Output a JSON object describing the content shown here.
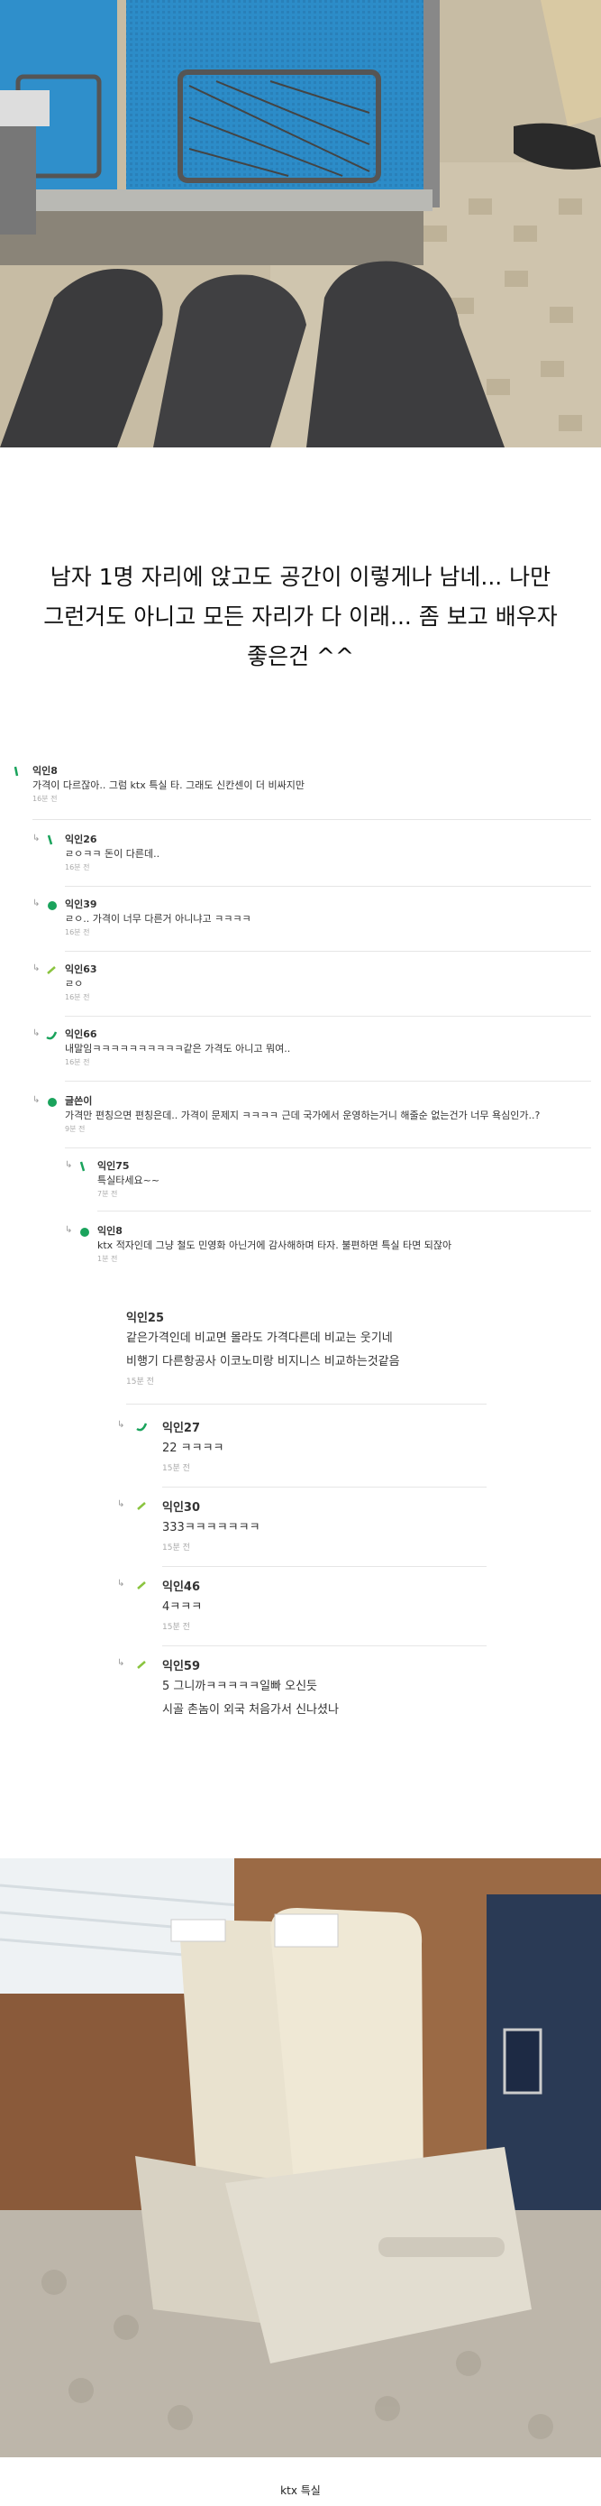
{
  "post": {
    "caption": "남자 1명 자리에 앉고도 공간이 이렇게나 남네... 나만\n그런거도 아니고 모든 자리가 다 이래... 좀 보고 배우자\n좋은건 ^^",
    "photo_bottom_caption": "ktx 특실"
  },
  "comments": [
    {
      "author": "익인8",
      "body": "가격이 다르잖아.. 그럼 ktx 특실 타. 그래도 신칸센이 더 비싸지만",
      "time": "16분 전"
    },
    {
      "author": "익인26",
      "body": "ㄹㅇㅋㅋ 돈이 다른데..",
      "time": "16분 전"
    },
    {
      "author": "익인39",
      "body": "ㄹㅇ.. 가격이 너무 다른거 아니냐고 ㅋㅋㅋㅋ",
      "time": "16분 전"
    },
    {
      "author": "익인63",
      "body": "ㄹㅇ",
      "time": "16분 전"
    },
    {
      "author": "익인66",
      "body": "내말임ㅋㅋㅋㅋㅋㅋㅋㅋㅋㅋ같은 가격도 아니고 뭐여..",
      "time": "16분 전"
    },
    {
      "author": "글쓴이",
      "body": "가격만 편칭으면 편칭은데.. 가격이 문제지 ㅋㅋㅋㅋ 근데 국가에서 운영하는거니 해줄순 없는건가 너무 욕심인가..?",
      "time": "9분 전"
    },
    {
      "author": "익인75",
      "body": "특실타세요~~",
      "time": "7분 전"
    },
    {
      "author": "익인8",
      "body": "ktx 적자인데 그냥 철도 민영화 아닌거에 감사해하며 타자. 불편하면 특실 타면 되잖아",
      "time": "1분 전"
    }
  ],
  "big_comments": [
    {
      "author": "익인25",
      "body_lines": [
        "같은가격인데 비교면 몰라도 가격다른데 비교는 웃기네",
        "비행기 다른항공사 이코노미랑 비지니스 비교하는것같음"
      ],
      "time": "15분 전"
    },
    {
      "author": "익인27",
      "body": "22 ㅋㅋㅋㅋ",
      "time": "15분 전"
    },
    {
      "author": "익인30",
      "body": "333ㅋㅋㅋㅋㅋㅋㅋ",
      "time": "15분 전"
    },
    {
      "author": "익인46",
      "body": "4ㅋㅋㅋ",
      "time": "15분 전"
    },
    {
      "author": "익인59",
      "body_lines": [
        "5 그니까ㅋㅋㅋㅋㅋ일빠 오신듯",
        "시골 촌놈이 외국 처음가서 신나셨나"
      ],
      "time": ""
    }
  ],
  "colors": {
    "accent_green": "#1aa35c",
    "seat_blue": "#2e8fc9",
    "cream_seat": "#e8e0cc"
  }
}
